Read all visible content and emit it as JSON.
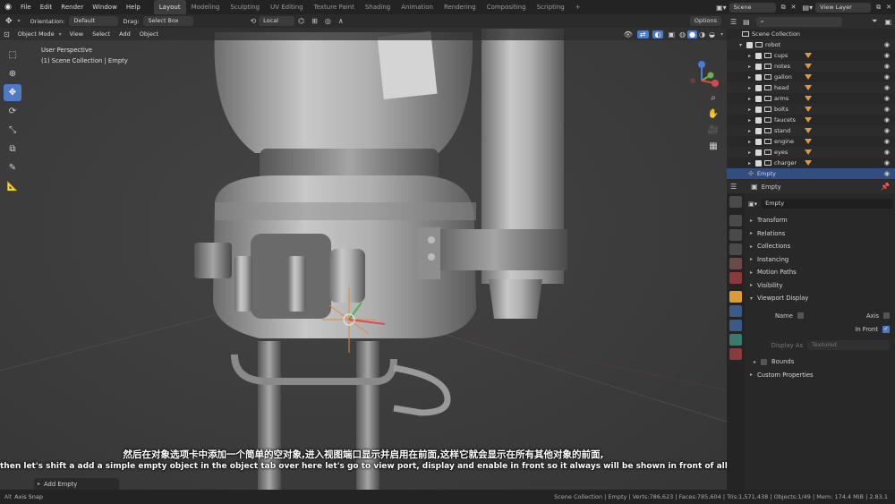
{
  "menu": {
    "items": [
      "File",
      "Edit",
      "Render",
      "Window",
      "Help"
    ]
  },
  "workspaces": {
    "tabs": [
      "Layout",
      "Modeling",
      "Sculpting",
      "UV Editing",
      "Texture Paint",
      "Shading",
      "Animation",
      "Rendering",
      "Compositing",
      "Scripting"
    ],
    "add": "+",
    "active_index": 0
  },
  "scene": {
    "label": "Scene",
    "view_layer": "View Layer"
  },
  "header_tools": {
    "orientation_label": "Orientation:",
    "orientation_value": "Default",
    "drag_label": "Drag:",
    "drag_value": "Select Box",
    "pivot_value": "Local",
    "options_label": "Options"
  },
  "viewport_header": {
    "mode": "Object Mode",
    "menus": [
      "View",
      "Select",
      "Add",
      "Object"
    ]
  },
  "viewport": {
    "view_name": "User Perspective",
    "collection_info": "(1) Scene Collection | Empty",
    "last_operator": "Add Empty",
    "gizmo_axes": [
      "Z",
      "Y",
      "X"
    ]
  },
  "subtitles": {
    "chinese": "然后在对象选项卡中添加一个简单的空对象,进入视图端口显示并启用在前面,这样它就会显示在所有其他对象的前面,",
    "english": "then let's shift a add a simple empty object in the object tab over here let's go to view port, display and enable in front so it always will be shown in front of all the other objects which,"
  },
  "outliner": {
    "root": "Scene Collection",
    "collection": "robot",
    "items": [
      {
        "name": "cups",
        "extra": ""
      },
      {
        "name": "notes",
        "extra": ""
      },
      {
        "name": "gallon",
        "extra": ""
      },
      {
        "name": "head",
        "extra": ""
      },
      {
        "name": "arms",
        "extra": ""
      },
      {
        "name": "bolts",
        "extra": ""
      },
      {
        "name": "faucets",
        "extra": ""
      },
      {
        "name": "stand",
        "extra": ""
      },
      {
        "name": "engine",
        "extra": ""
      },
      {
        "name": "eyes",
        "extra": ""
      },
      {
        "name": "charger",
        "extra": ""
      }
    ],
    "selected": "Empty"
  },
  "properties": {
    "object_name": "Empty",
    "data_name": "Empty",
    "panels": [
      "Transform",
      "Relations",
      "Collections",
      "Instancing",
      "Motion Paths",
      "Visibility",
      "Viewport Display"
    ],
    "viewport_display": {
      "name_label": "Name",
      "axis_label": "Axis",
      "in_front_label": "In Front",
      "display_as_label": "Display As",
      "display_as_value": "Textured",
      "bounds_label": "Bounds"
    },
    "custom_properties": "Custom Properties"
  },
  "statusbar": {
    "left": "Axis Snap",
    "right": "Scene Collection | Empty | Verts:786,623 | Faces:785,604 | Tris:1,571,438 | Objects:1/49 | Mem: 174.4 MiB | 2.83.1"
  },
  "colors": {
    "accent_blue": "#4f7bc4",
    "selection_row": "#334d80",
    "object_orange": "#e09a33",
    "viewport_bg": "#3c3c3c"
  }
}
